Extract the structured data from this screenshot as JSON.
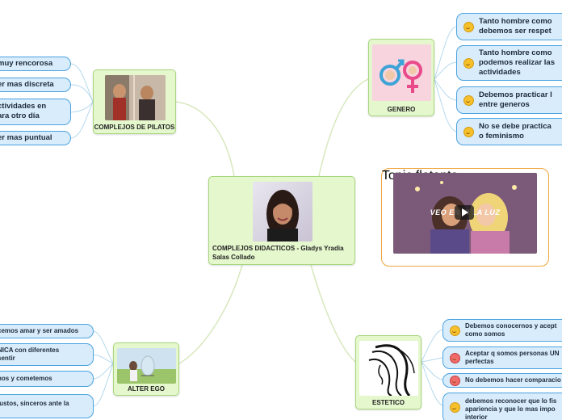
{
  "central": {
    "title": "COMPLEJOS DIDACTICOS - Gladys Yradia Salas Collado",
    "image": "woman-portrait"
  },
  "pilatos": {
    "title": "COMPLEJOS DE PILATOS",
    "image": "pilate-scene",
    "items": [
      "muy rencorosa",
      "er mas discreta",
      "ctividades en",
      "ara otro día",
      "er mas puntual"
    ]
  },
  "genero": {
    "title": "GENERO",
    "image": "gender-symbols",
    "items": [
      [
        "Tanto hombre como",
        "debemos ser respet"
      ],
      [
        "Tanto hombre como",
        "podemos realizar las",
        "actividades"
      ],
      [
        "Debemos practicar l",
        "entre generos"
      ],
      [
        "No se debe practica",
        "o feminismo"
      ]
    ]
  },
  "floating": {
    "title": "Topic flotante",
    "video_text": "VEO EN TI LA LUZ",
    "image": "video-thumbnail"
  },
  "alter_ego": {
    "title": "ALTER EGO",
    "image": "girl-mirror",
    "items": [
      "cemos amar y ser amados",
      [
        "NICA con diferentes",
        "sentir"
      ],
      "nos y cometemos",
      "justos, sinceros ante la"
    ]
  },
  "estetico": {
    "title": "ESTETICO",
    "image": "hair-silhouette",
    "items": [
      [
        "Debemos conocernos y acept",
        "como somos"
      ],
      [
        "Aceptar q somos personas UN",
        "perfectas"
      ],
      "No debemos hacer comparacio",
      [
        "debemos reconocer que lo fis",
        "apariencia y que lo mas impo",
        "interior"
      ]
    ]
  },
  "colors": {
    "topic_fill": "#e5f7cd",
    "topic_border": "#a8d67e",
    "pill_fill": "#d9ecfb",
    "pill_border": "#4aa3df",
    "float_border": "#f0a43a",
    "connector": "#d7e8bd"
  }
}
